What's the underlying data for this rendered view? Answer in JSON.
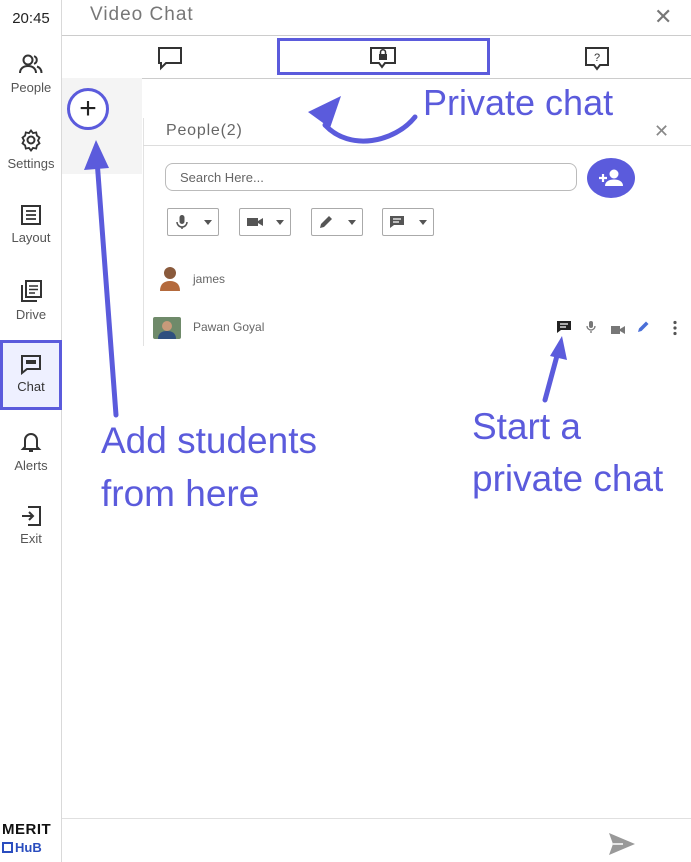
{
  "rail": {
    "clock": "20:45",
    "items": [
      {
        "label": "People",
        "icon": "people-icon"
      },
      {
        "label": "Settings",
        "icon": "gear-icon"
      },
      {
        "label": "Layout",
        "icon": "layout-icon"
      },
      {
        "label": "Drive",
        "icon": "drive-icon"
      },
      {
        "label": "Chat",
        "icon": "chat-icon",
        "active": true
      },
      {
        "label": "Alerts",
        "icon": "bell-icon"
      },
      {
        "label": "Exit",
        "icon": "exit-icon"
      }
    ],
    "brand_line1": "MERIT",
    "brand_line2": "HuB"
  },
  "header": {
    "title": "Video Chat",
    "close_symbol": "✕"
  },
  "tabs": [
    {
      "icon": "chat-bubble-icon"
    },
    {
      "icon": "lock-chat-icon",
      "highlighted": true
    },
    {
      "icon": "question-chat-icon"
    }
  ],
  "people_panel": {
    "title": "People(2)",
    "close_symbol": "✕",
    "search_placeholder": "Search Here...",
    "controls": [
      "mic-dropdown",
      "video-dropdown",
      "pen-dropdown",
      "chat-dropdown"
    ],
    "people": [
      {
        "name": "james",
        "avatar": "avatar-james"
      },
      {
        "name": "Pawan Goyal",
        "avatar": "avatar-pawan",
        "actions": [
          "private-chat-icon",
          "mic-icon",
          "video-icon",
          "pen-icon",
          "more-icon"
        ]
      }
    ]
  },
  "annotations": {
    "private_chat": "Private chat",
    "add_students_line1": "Add students",
    "add_students_line2": "from here",
    "start_private_line1": "Start a",
    "start_private_line2": "private chat"
  },
  "colors": {
    "accent": "#5b5bdc",
    "annotation": "#5b5bdc",
    "text_muted": "#777777"
  }
}
